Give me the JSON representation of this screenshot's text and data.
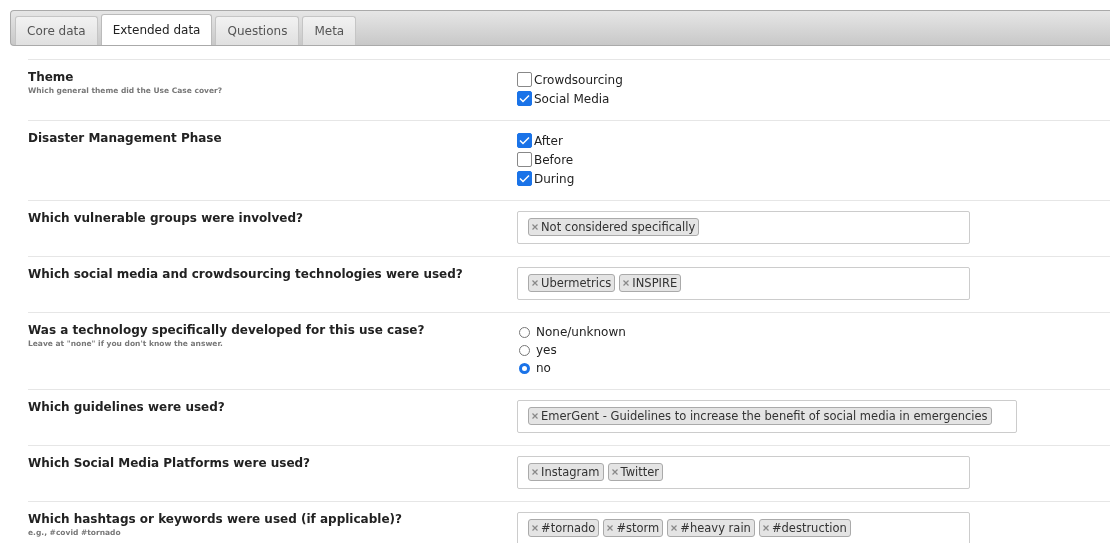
{
  "tabs": [
    {
      "label": "Core data",
      "selected": false
    },
    {
      "label": "Extended data",
      "selected": true
    },
    {
      "label": "Questions",
      "selected": false
    },
    {
      "label": "Meta",
      "selected": false
    }
  ],
  "fields": [
    {
      "label": "Theme",
      "help": "Which general theme did the Use Case cover?",
      "kind": "checkbox",
      "options": [
        {
          "label": "Crowdsourcing",
          "checked": false
        },
        {
          "label": "Social Media",
          "checked": true
        }
      ]
    },
    {
      "label": "Disaster Management Phase",
      "kind": "checkbox",
      "options": [
        {
          "label": "After",
          "checked": true
        },
        {
          "label": "Before",
          "checked": false
        },
        {
          "label": "During",
          "checked": true
        }
      ]
    },
    {
      "label": "Which vulnerable groups were involved?",
      "kind": "tags",
      "tags": [
        "Not considered specifically"
      ]
    },
    {
      "label": "Which social media and crowdsourcing technologies were used?",
      "kind": "tags",
      "tags": [
        "Ubermetrics",
        "INSPIRE"
      ]
    },
    {
      "label": "Was a technology specifically developed for this use case?",
      "help": "Leave at \"none\" if you don't know the answer.",
      "kind": "radio",
      "options": [
        {
          "label": "None/unknown",
          "selected": false
        },
        {
          "label": "yes",
          "selected": false
        },
        {
          "label": "no",
          "selected": true
        }
      ]
    },
    {
      "label": "Which guidelines were used?",
      "kind": "tags",
      "tags": [
        "EmerGent - Guidelines to increase the benefit of social media in emergencies"
      ]
    },
    {
      "label": "Which Social Media Platforms were used?",
      "kind": "tags",
      "tags": [
        "Instagram",
        "Twitter"
      ]
    },
    {
      "label": "Which hashtags or keywords were used (if applicable)?",
      "help": "e.g., #covid #tornado",
      "kind": "tags",
      "tags": [
        "#tornado",
        "#storm",
        "#heavy rain",
        "#destruction"
      ]
    }
  ]
}
